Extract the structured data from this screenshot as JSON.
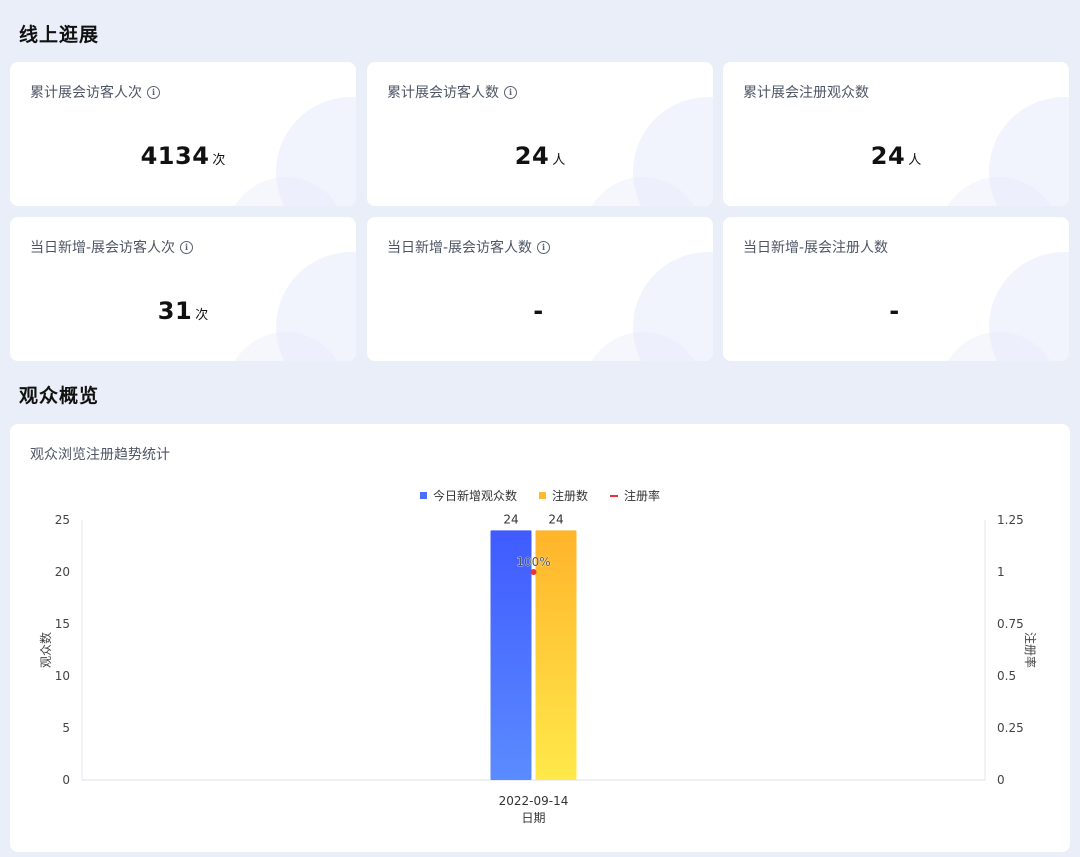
{
  "sections": {
    "online": "线上逛展",
    "audience": "观众概览"
  },
  "stats": [
    {
      "label": "累计展会访客人次",
      "value": "4134",
      "unit": "次",
      "info": true
    },
    {
      "label": "累计展会访客人数",
      "value": "24",
      "unit": "人",
      "info": true
    },
    {
      "label": "累计展会注册观众数",
      "value": "24",
      "unit": "人",
      "info": false
    },
    {
      "label": "当日新增-展会访客人次",
      "value": "31",
      "unit": "次",
      "info": true
    },
    {
      "label": "当日新增-展会访客人数",
      "value": "-",
      "unit": "",
      "info": true
    },
    {
      "label": "当日新增-展会注册人数",
      "value": "-",
      "unit": "",
      "info": false
    }
  ],
  "chart_card": {
    "title": "观众浏览注册趋势统计"
  },
  "chart_data": {
    "type": "bar",
    "categories": [
      "2022-09-14"
    ],
    "series": [
      {
        "name": "今日新增观众数",
        "kind": "bar",
        "values": [
          24
        ],
        "color": "#4a6cff"
      },
      {
        "name": "注册数",
        "kind": "bar",
        "values": [
          24
        ],
        "color": "#ffbb2e"
      },
      {
        "name": "注册率",
        "kind": "line",
        "axis": "right",
        "values": [
          1
        ],
        "color": "#e8323c",
        "label": "100%"
      }
    ],
    "xlabel": "日期",
    "ylabel": "观众数",
    "ylabel_right": "注册率",
    "ylim": [
      0,
      25
    ],
    "yticks": [
      "0",
      "5",
      "10",
      "15",
      "20",
      "25"
    ],
    "ylim_right": [
      0,
      1.25
    ],
    "yticks_right": [
      "0",
      "0.25",
      "0.5",
      "0.75",
      "1",
      "1.25"
    ],
    "legend_position": "top-center",
    "grid": false
  }
}
